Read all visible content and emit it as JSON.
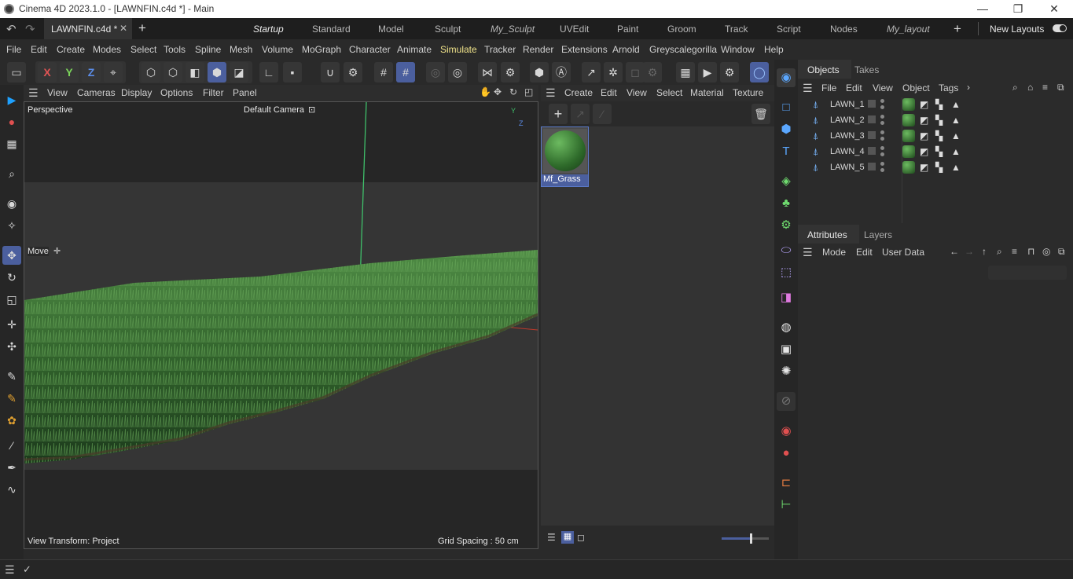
{
  "window": {
    "title": "Cinema 4D 2023.1.0 - [LAWNFIN.c4d *] - Main",
    "minimize": "—",
    "restore": "❐",
    "close": "✕"
  },
  "tabbar": {
    "document_tab": "LAWNFIN.c4d *",
    "layouts": [
      "Startup",
      "Standard",
      "Model",
      "Sculpt",
      "My_Sculpt",
      "UVEdit",
      "Paint",
      "Groom",
      "Track",
      "Script",
      "Nodes",
      "My_layout"
    ],
    "new_layouts": "New Layouts"
  },
  "menubar": [
    "File",
    "Edit",
    "Create",
    "Modes",
    "Select",
    "Tools",
    "Spline",
    "Mesh",
    "Volume",
    "MoGraph",
    "Character",
    "Animate",
    "Simulate",
    "Tracker",
    "Render",
    "Extensions",
    "Arnold",
    "Greyscalegorilla",
    "Window",
    "Help"
  ],
  "toolbar": {
    "x": "X",
    "y": "Y",
    "z": "Z"
  },
  "viewport": {
    "menu": [
      "View",
      "Cameras",
      "Display",
      "Options",
      "Filter",
      "Panel"
    ],
    "perspective": "Perspective",
    "camera": "Default Camera",
    "tool": "Move",
    "view_transform": "View Transform: Project",
    "grid_spacing": "Grid Spacing : 50 cm",
    "axis_y": "Y",
    "axis_z": "Z"
  },
  "material_manager": {
    "menu": [
      "Create",
      "Edit",
      "View",
      "Select",
      "Material",
      "Texture"
    ],
    "materials": [
      {
        "name": "Mf_Grass"
      }
    ]
  },
  "objects_panel": {
    "tabs": [
      "Objects",
      "Takes"
    ],
    "menu": [
      "File",
      "Edit",
      "View",
      "Object",
      "Tags"
    ],
    "objects": [
      {
        "name": "LAWN_1"
      },
      {
        "name": "LAWN_2"
      },
      {
        "name": "LAWN_3"
      },
      {
        "name": "LAWN_4"
      },
      {
        "name": "LAWN_5"
      }
    ]
  },
  "attributes_panel": {
    "tabs": [
      "Attributes",
      "Layers"
    ],
    "menu": [
      "Mode",
      "Edit",
      "User Data"
    ]
  },
  "colors": {
    "accent": "#4b5f9e",
    "simulate": "#f0e38a",
    "grass_dark": "#17321a",
    "grass_light": "#3f7a36"
  }
}
